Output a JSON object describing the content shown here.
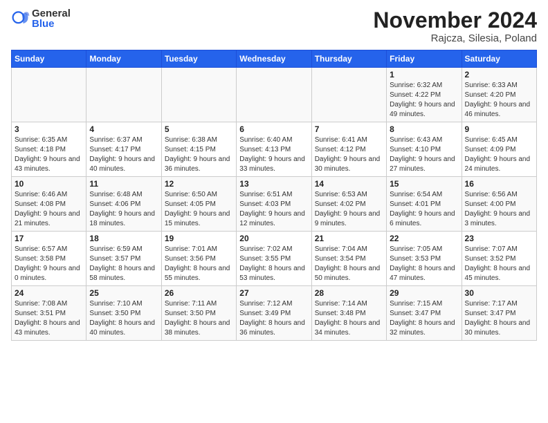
{
  "logo": {
    "general": "General",
    "blue": "Blue"
  },
  "title": "November 2024",
  "subtitle": "Rajcza, Silesia, Poland",
  "weekdays": [
    "Sunday",
    "Monday",
    "Tuesday",
    "Wednesday",
    "Thursday",
    "Friday",
    "Saturday"
  ],
  "weeks": [
    [
      {
        "day": "",
        "info": ""
      },
      {
        "day": "",
        "info": ""
      },
      {
        "day": "",
        "info": ""
      },
      {
        "day": "",
        "info": ""
      },
      {
        "day": "",
        "info": ""
      },
      {
        "day": "1",
        "info": "Sunrise: 6:32 AM\nSunset: 4:22 PM\nDaylight: 9 hours and 49 minutes."
      },
      {
        "day": "2",
        "info": "Sunrise: 6:33 AM\nSunset: 4:20 PM\nDaylight: 9 hours and 46 minutes."
      }
    ],
    [
      {
        "day": "3",
        "info": "Sunrise: 6:35 AM\nSunset: 4:18 PM\nDaylight: 9 hours and 43 minutes."
      },
      {
        "day": "4",
        "info": "Sunrise: 6:37 AM\nSunset: 4:17 PM\nDaylight: 9 hours and 40 minutes."
      },
      {
        "day": "5",
        "info": "Sunrise: 6:38 AM\nSunset: 4:15 PM\nDaylight: 9 hours and 36 minutes."
      },
      {
        "day": "6",
        "info": "Sunrise: 6:40 AM\nSunset: 4:13 PM\nDaylight: 9 hours and 33 minutes."
      },
      {
        "day": "7",
        "info": "Sunrise: 6:41 AM\nSunset: 4:12 PM\nDaylight: 9 hours and 30 minutes."
      },
      {
        "day": "8",
        "info": "Sunrise: 6:43 AM\nSunset: 4:10 PM\nDaylight: 9 hours and 27 minutes."
      },
      {
        "day": "9",
        "info": "Sunrise: 6:45 AM\nSunset: 4:09 PM\nDaylight: 9 hours and 24 minutes."
      }
    ],
    [
      {
        "day": "10",
        "info": "Sunrise: 6:46 AM\nSunset: 4:08 PM\nDaylight: 9 hours and 21 minutes."
      },
      {
        "day": "11",
        "info": "Sunrise: 6:48 AM\nSunset: 4:06 PM\nDaylight: 9 hours and 18 minutes."
      },
      {
        "day": "12",
        "info": "Sunrise: 6:50 AM\nSunset: 4:05 PM\nDaylight: 9 hours and 15 minutes."
      },
      {
        "day": "13",
        "info": "Sunrise: 6:51 AM\nSunset: 4:03 PM\nDaylight: 9 hours and 12 minutes."
      },
      {
        "day": "14",
        "info": "Sunrise: 6:53 AM\nSunset: 4:02 PM\nDaylight: 9 hours and 9 minutes."
      },
      {
        "day": "15",
        "info": "Sunrise: 6:54 AM\nSunset: 4:01 PM\nDaylight: 9 hours and 6 minutes."
      },
      {
        "day": "16",
        "info": "Sunrise: 6:56 AM\nSunset: 4:00 PM\nDaylight: 9 hours and 3 minutes."
      }
    ],
    [
      {
        "day": "17",
        "info": "Sunrise: 6:57 AM\nSunset: 3:58 PM\nDaylight: 9 hours and 0 minutes."
      },
      {
        "day": "18",
        "info": "Sunrise: 6:59 AM\nSunset: 3:57 PM\nDaylight: 8 hours and 58 minutes."
      },
      {
        "day": "19",
        "info": "Sunrise: 7:01 AM\nSunset: 3:56 PM\nDaylight: 8 hours and 55 minutes."
      },
      {
        "day": "20",
        "info": "Sunrise: 7:02 AM\nSunset: 3:55 PM\nDaylight: 8 hours and 53 minutes."
      },
      {
        "day": "21",
        "info": "Sunrise: 7:04 AM\nSunset: 3:54 PM\nDaylight: 8 hours and 50 minutes."
      },
      {
        "day": "22",
        "info": "Sunrise: 7:05 AM\nSunset: 3:53 PM\nDaylight: 8 hours and 47 minutes."
      },
      {
        "day": "23",
        "info": "Sunrise: 7:07 AM\nSunset: 3:52 PM\nDaylight: 8 hours and 45 minutes."
      }
    ],
    [
      {
        "day": "24",
        "info": "Sunrise: 7:08 AM\nSunset: 3:51 PM\nDaylight: 8 hours and 43 minutes."
      },
      {
        "day": "25",
        "info": "Sunrise: 7:10 AM\nSunset: 3:50 PM\nDaylight: 8 hours and 40 minutes."
      },
      {
        "day": "26",
        "info": "Sunrise: 7:11 AM\nSunset: 3:50 PM\nDaylight: 8 hours and 38 minutes."
      },
      {
        "day": "27",
        "info": "Sunrise: 7:12 AM\nSunset: 3:49 PM\nDaylight: 8 hours and 36 minutes."
      },
      {
        "day": "28",
        "info": "Sunrise: 7:14 AM\nSunset: 3:48 PM\nDaylight: 8 hours and 34 minutes."
      },
      {
        "day": "29",
        "info": "Sunrise: 7:15 AM\nSunset: 3:47 PM\nDaylight: 8 hours and 32 minutes."
      },
      {
        "day": "30",
        "info": "Sunrise: 7:17 AM\nSunset: 3:47 PM\nDaylight: 8 hours and 30 minutes."
      }
    ]
  ]
}
